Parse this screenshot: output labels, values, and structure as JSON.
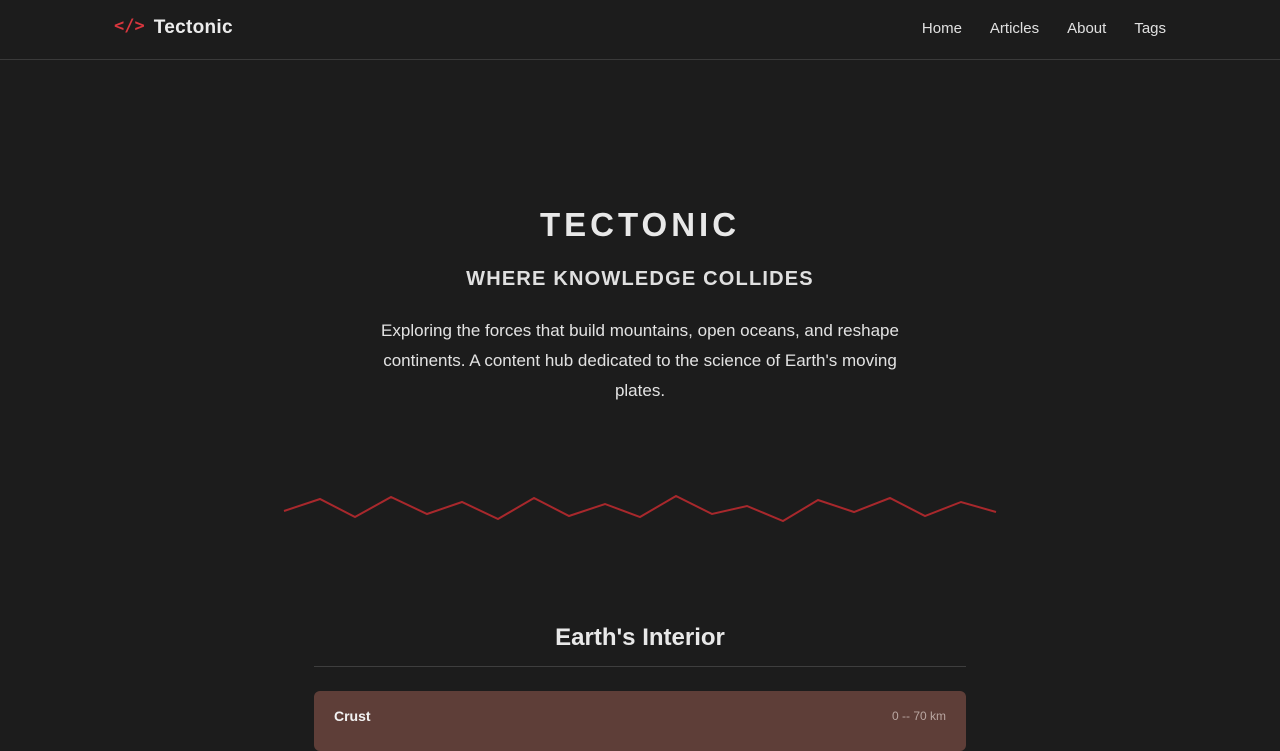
{
  "nav": {
    "brand_icon": "</>",
    "brand_name": "Tectonic",
    "links": [
      "Home",
      "Articles",
      "About",
      "Tags"
    ]
  },
  "hero": {
    "title": "TECTONIC",
    "subtitle": "WHERE KNOWLEDGE COLLIDES",
    "description": "Exploring the forces that build mountains, open oceans, and reshape continents. A content hub dedicated to the science of Earth's moving plates."
  },
  "section": {
    "title": "Earth's Interior",
    "layers": [
      {
        "name": "Crust",
        "depth": "0 -- 70 km"
      }
    ]
  },
  "colors": {
    "background": "#1c1c1c",
    "accent": "#d9363e",
    "fault_line": "#a8282c",
    "crust_card": "#5e3e38"
  },
  "icons": {
    "brand": "code-brackets-icon"
  }
}
